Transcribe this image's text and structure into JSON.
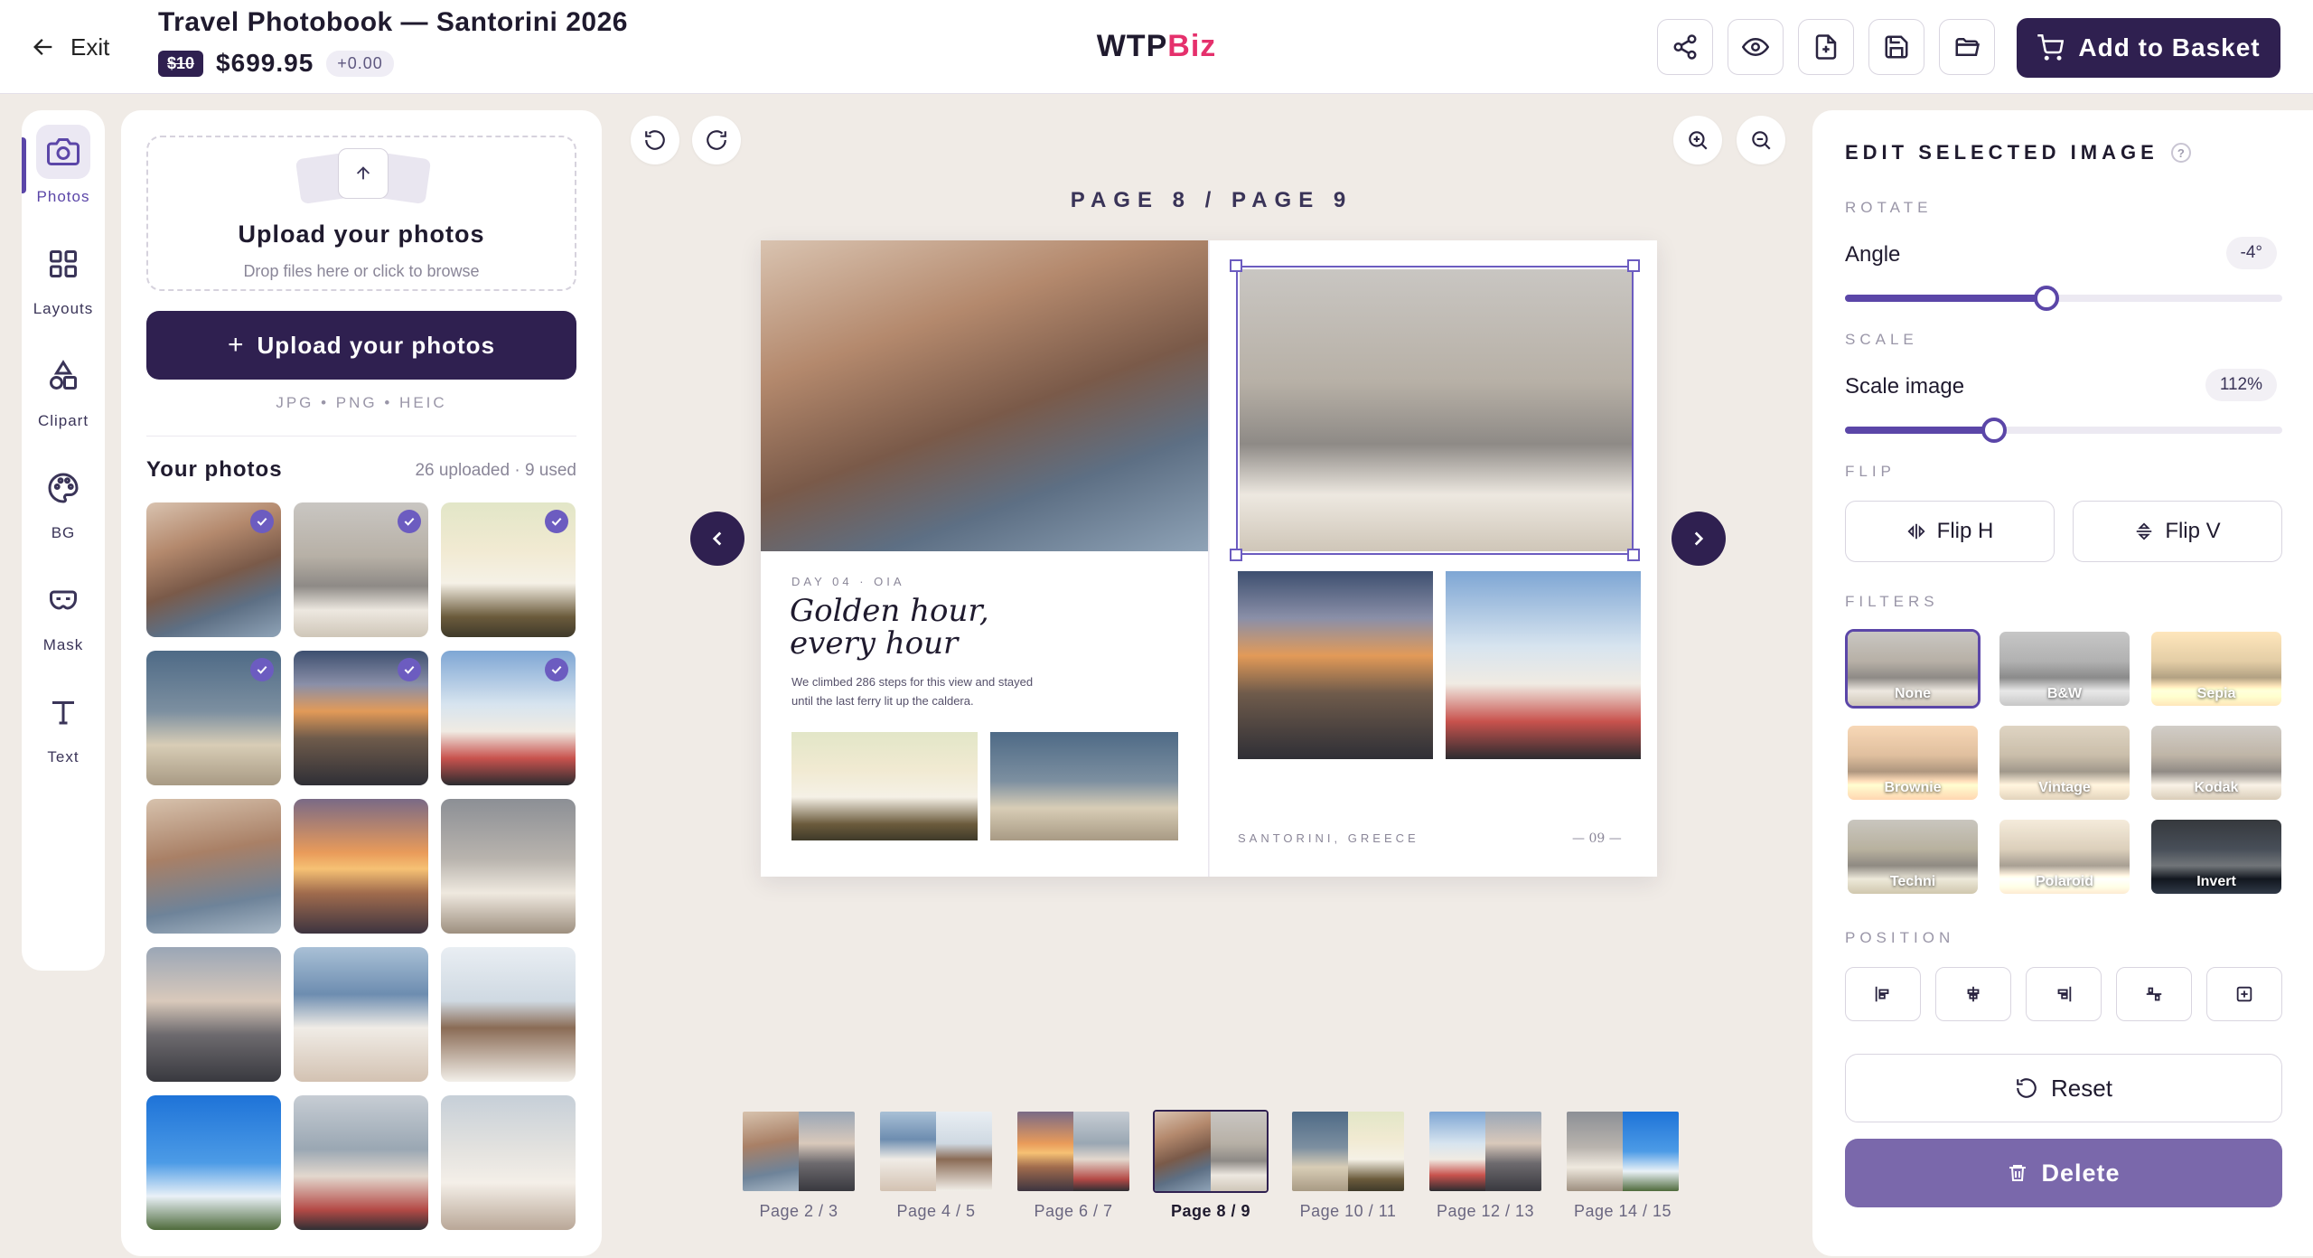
{
  "header": {
    "exit_label": "Exit",
    "doc_title": "Travel Photobook — Santorini 2026",
    "old_price": "$10",
    "price": "$699.95",
    "price_delta": "+0.00",
    "brand_a": "WTP",
    "brand_b": "Biz",
    "basket_label": "Add to Basket",
    "tool_icons": [
      "share-icon",
      "eye-icon",
      "add-page-icon",
      "save-icon",
      "folder-icon"
    ]
  },
  "rail": [
    {
      "label": "Photos",
      "icon": "camera-icon",
      "active": true
    },
    {
      "label": "Layouts",
      "icon": "grid-icon",
      "active": false
    },
    {
      "label": "Clipart",
      "icon": "shapes-icon",
      "active": false
    },
    {
      "label": "BG",
      "icon": "palette-icon",
      "active": false
    },
    {
      "label": "Mask",
      "icon": "mask-icon",
      "active": false
    },
    {
      "label": "Text",
      "icon": "text-icon",
      "active": false
    }
  ],
  "upload": {
    "dropzone_title": "Upload your photos",
    "dropzone_sub": "Drop files here or click to browse",
    "button_label": "Upload your photos",
    "formats": "JPG • PNG • HEIC"
  },
  "photos": {
    "title": "Your photos",
    "count": "26 uploaded · 9 used",
    "items": [
      {
        "scene": "rocks",
        "used": true
      },
      {
        "scene": "couple-wall",
        "used": true
      },
      {
        "scene": "oia-domes",
        "used": true
      },
      {
        "scene": "hats-sea",
        "used": true
      },
      {
        "scene": "cliff-sunset",
        "used": true
      },
      {
        "scene": "selfie",
        "used": true
      },
      {
        "scene": "rocks-hug",
        "used": false
      },
      {
        "scene": "sunset-sea",
        "used": false
      },
      {
        "scene": "kiss-terrace",
        "used": false
      },
      {
        "scene": "dusk-cliffs",
        "used": false
      },
      {
        "scene": "harbor-kiss",
        "used": false
      },
      {
        "scene": "map-tourist",
        "used": false
      },
      {
        "scene": "blue-sky-town",
        "used": false
      },
      {
        "scene": "boats-kiss",
        "used": false
      },
      {
        "scene": "white-dress",
        "used": false
      }
    ]
  },
  "canvas": {
    "page_label": "PAGE 8 / PAGE 9",
    "day_label": "DAY 04 · OIA",
    "headline_1": "Golden hour,",
    "headline_2": "every hour",
    "body_1": "We climbed 286 steps for this view and stayed",
    "body_2": "until the last ferry lit up the caldera.",
    "place": "SANTORINI, GREECE",
    "page_number": "— 09 —"
  },
  "filmstrip": [
    {
      "label": "Page 2 / 3",
      "active": false
    },
    {
      "label": "Page 4 / 5",
      "active": false
    },
    {
      "label": "Page 6 / 7",
      "active": false
    },
    {
      "label": "Page 8 / 9",
      "active": true
    },
    {
      "label": "Page 10 / 11",
      "active": false
    },
    {
      "label": "Page 12 / 13",
      "active": false
    },
    {
      "label": "Page 14 / 15",
      "active": false
    }
  ],
  "editor": {
    "title": "EDIT SELECTED IMAGE",
    "rotate_section": "ROTATE",
    "angle_label": "Angle",
    "angle_value": "-4°",
    "angle_fraction": 0.46,
    "scale_section": "SCALE",
    "scale_label": "Scale image",
    "scale_value": "112%",
    "scale_fraction": 0.34,
    "flip_section": "FLIP",
    "flip_h": "Flip H",
    "flip_v": "Flip V",
    "filters_section": "FILTERS",
    "filters": [
      {
        "name": "None",
        "active": true
      },
      {
        "name": "B&W",
        "active": false
      },
      {
        "name": "Sepia",
        "active": false
      },
      {
        "name": "Brownie",
        "active": false
      },
      {
        "name": "Vintage",
        "active": false
      },
      {
        "name": "Kodak",
        "active": false
      },
      {
        "name": "Techni",
        "active": false
      },
      {
        "name": "Polaroid",
        "active": false
      },
      {
        "name": "Invert",
        "active": false
      }
    ],
    "position_section": "POSITION",
    "reset_label": "Reset",
    "delete_label": "Delete"
  },
  "colors": {
    "brand_dark": "#2f2050",
    "accent": "#5b46a8",
    "brand_pink": "#e5306c",
    "delete": "#7a68ab"
  }
}
